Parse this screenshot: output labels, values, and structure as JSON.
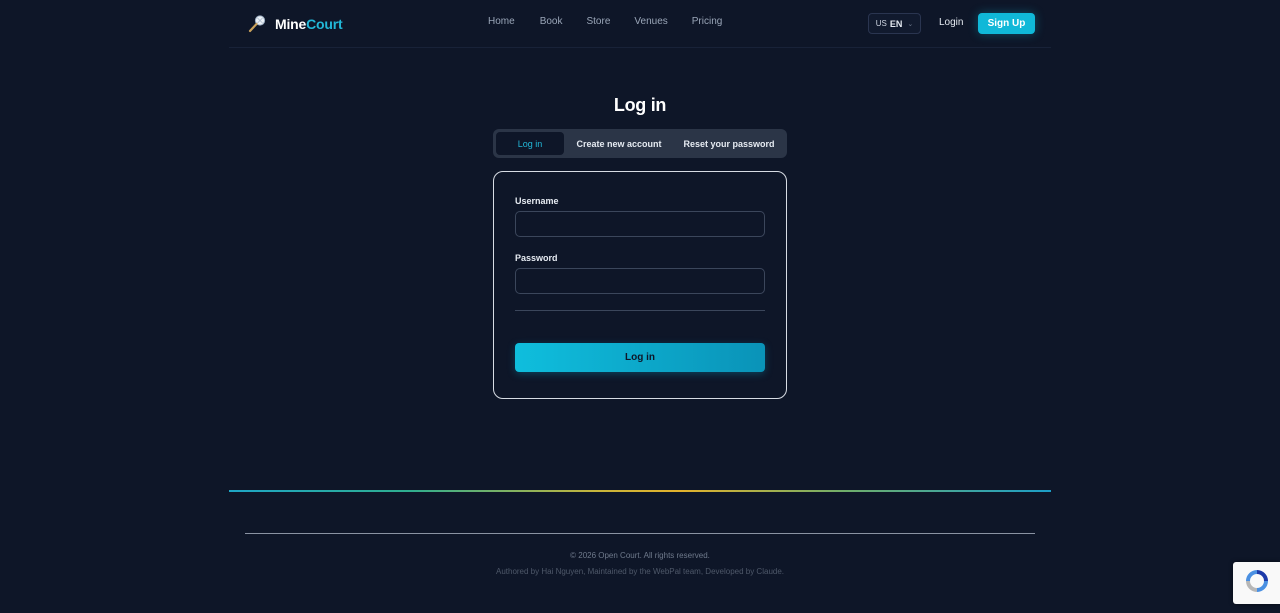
{
  "brand": {
    "name_part1": "Mine",
    "name_part2": "Court"
  },
  "nav": {
    "items": [
      {
        "label": "Home"
      },
      {
        "label": "Book"
      },
      {
        "label": "Store"
      },
      {
        "label": "Venues"
      },
      {
        "label": "Pricing"
      }
    ]
  },
  "language": {
    "flag": "US",
    "code": "EN"
  },
  "header_actions": {
    "login": "Login",
    "signup": "Sign Up"
  },
  "page": {
    "title": "Log in"
  },
  "tabs": [
    {
      "label": "Log in",
      "active": true
    },
    {
      "label": "Create new account",
      "active": false
    },
    {
      "label": "Reset your password",
      "active": false
    }
  ],
  "form": {
    "username_label": "Username",
    "username_value": "",
    "password_label": "Password",
    "password_value": "",
    "submit_label": "Log in"
  },
  "footer": {
    "copyright": "© 2026 Open Court. All rights reserved.",
    "credits": "Authored by Hai Nguyen, Maintained by the WebPal team, Developed by Claude."
  },
  "colors": {
    "background": "#0e1628",
    "accent": "#10b8d8",
    "tab_track": "#2b3547"
  }
}
